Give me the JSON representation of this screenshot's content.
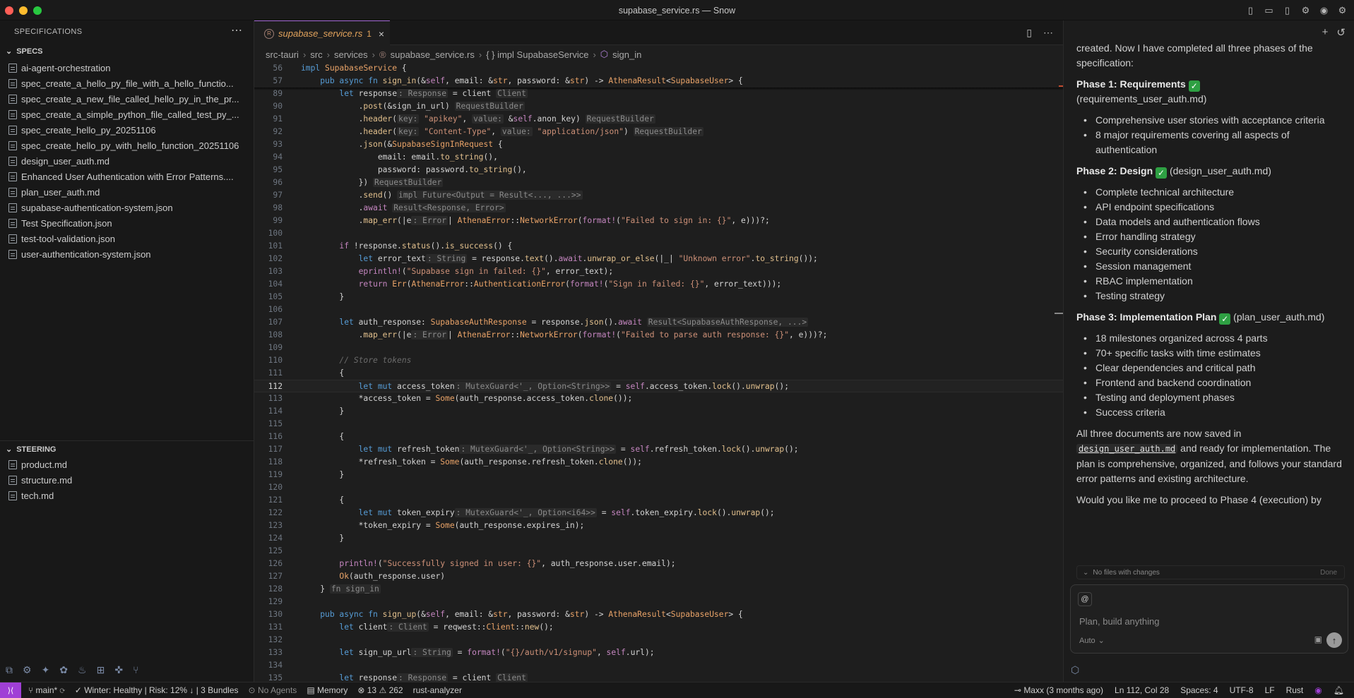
{
  "window": {
    "title": "supabase_service.rs — Snow",
    "traffic_colors": [
      "#ff5f57",
      "#febc2e",
      "#28c840"
    ]
  },
  "sidebar": {
    "header": "SPECIFICATIONS",
    "more": "⋯",
    "specs": {
      "title": "SPECS",
      "items": [
        "ai-agent-orchestration",
        "spec_create_a_hello_py_file_with_a_hello_functio...",
        "spec_create_a_new_file_called_hello_py_in_the_pr...",
        "spec_create_a_simple_python_file_called_test_py_...",
        "spec_create_hello_py_20251106",
        "spec_create_hello_py_with_hello_function_20251106",
        "design_user_auth.md",
        "Enhanced User Authentication with Error Patterns....",
        "plan_user_auth.md",
        "supabase-authentication-system.json",
        "Test Specification.json",
        "test-tool-validation.json",
        "user-authentication-system.json"
      ]
    },
    "steering": {
      "title": "STEERING",
      "items": [
        "product.md",
        "structure.md",
        "tech.md"
      ]
    }
  },
  "editor": {
    "tab": {
      "name": "supabase_service.rs",
      "badge": "1",
      "icon": "rust-icon"
    },
    "breadcrumb": [
      "src-tauri",
      "src",
      "services",
      "supabase_service.rs",
      "{ } impl SupabaseService",
      "sign_in"
    ],
    "cursor_line": "112"
  },
  "chat": {
    "intro": "created. Now I have completed all three phases of the specification:",
    "phases": [
      {
        "title": "Phase 1: Requirements",
        "file": "(requirements_user_auth.md)",
        "items": [
          "Comprehensive user stories with acceptance criteria",
          "8 major requirements covering all aspects of authentication"
        ]
      },
      {
        "title": "Phase 2: Design",
        "file": "(design_user_auth.md)",
        "items": [
          "Complete technical architecture",
          "API endpoint specifications",
          "Data models and authentication flows",
          "Error handling strategy",
          "Security considerations",
          "Session management",
          "RBAC implementation",
          "Testing strategy"
        ]
      },
      {
        "title": "Phase 3: Implementation Plan",
        "file": "(plan_user_auth.md)",
        "items": [
          "18 milestones organized across 4 parts",
          "70+ specific tasks with time estimates",
          "Clear dependencies and critical path",
          "Frontend and backend coordination",
          "Testing and deployment phases",
          "Success criteria"
        ]
      }
    ],
    "summary_pre": "All three documents are now saved in",
    "summary_code": "design_user_auth.md",
    "summary_post": "and ready for implementation. The plan is comprehensive, organized, and follows your standard error patterns and existing architecture.",
    "question": "Would you like me to proceed to Phase 4 (execution) by",
    "changes_label": "No files with changes",
    "changes_done": "Done",
    "input_at": "@",
    "input_placeholder": "Plan, build anything",
    "mode": "Auto"
  },
  "status": {
    "branch": "main*",
    "winter": "Winter: Healthy",
    "risk": "| Risk: 12% ↓ | 3 Bundles",
    "agents": "No Agents",
    "memory": "Memory",
    "errors": "13",
    "warnings": "262",
    "server": "rust-analyzer",
    "blame": "Maxx (3 months ago)",
    "position": "Ln 112, Col 28",
    "spaces": "Spaces: 4",
    "encoding": "UTF-8",
    "eol": "LF",
    "language": "Rust"
  }
}
